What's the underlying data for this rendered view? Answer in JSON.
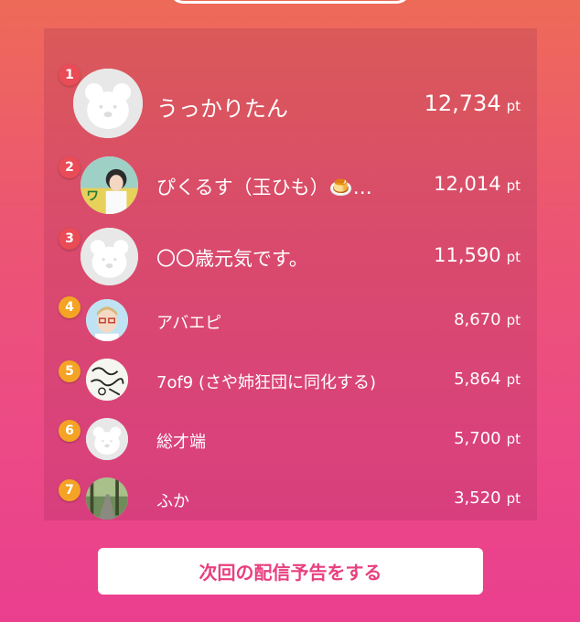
{
  "ranking": [
    {
      "rank": "1",
      "name": "うっかりたん",
      "score": "12,734",
      "unit": "pt",
      "avatar": "bear-default-avatar",
      "badge_color": "#e94b57"
    },
    {
      "rank": "2",
      "name": "ぴくるす（玉ひも）🍮…",
      "score": "12,014",
      "unit": "pt",
      "avatar": "photo-avatar",
      "badge_color": "#e94b57"
    },
    {
      "rank": "3",
      "name": "〇〇歳元気です。",
      "score": "11,590",
      "unit": "pt",
      "avatar": "bear-default-avatar",
      "badge_color": "#e94b57"
    },
    {
      "rank": "4",
      "name": "アバエピ",
      "score": "8,670",
      "unit": "pt",
      "avatar": "illustration-avatar",
      "badge_color": "#f4a325"
    },
    {
      "rank": "5",
      "name": "7of9 (さや姉狂団に同化する)",
      "score": "5,864",
      "unit": "pt",
      "avatar": "handwriting-avatar",
      "badge_color": "#f4a325"
    },
    {
      "rank": "6",
      "name": "総才端",
      "score": "5,700",
      "unit": "pt",
      "avatar": "bear-default-avatar",
      "badge_color": "#f4a325"
    },
    {
      "rank": "7",
      "name": "ふか",
      "score": "3,520",
      "unit": "pt",
      "avatar": "nature-photo-avatar",
      "badge_color": "#f4a325"
    }
  ],
  "cta": {
    "label": "次回の配信予告をする"
  },
  "colors": {
    "accent": "#e8407f",
    "top_rank_badge": "#e94b57",
    "rank_badge": "#f4a325"
  }
}
